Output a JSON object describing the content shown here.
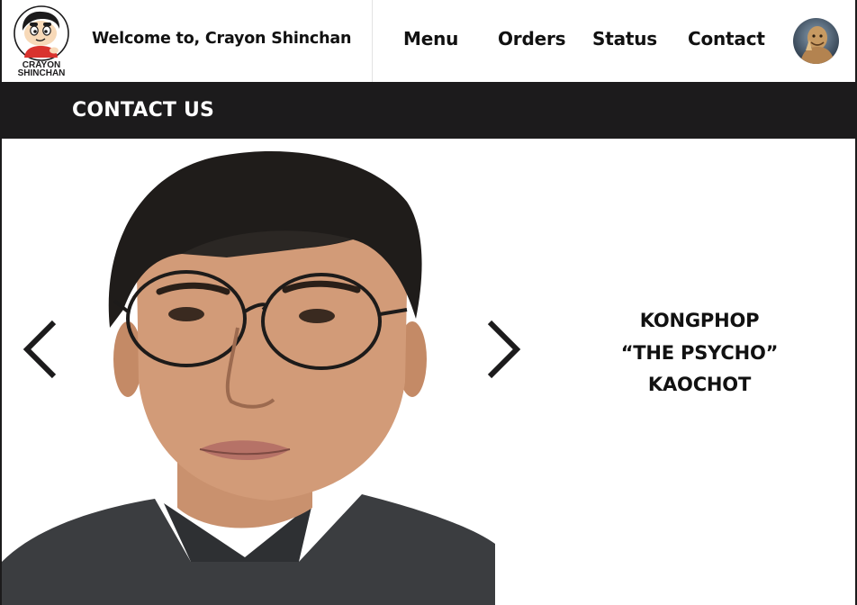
{
  "header": {
    "logo_lines": [
      "CRAYON",
      "SHINCHAN"
    ],
    "welcome_text": "Welcome to, Crayon Shinchan",
    "nav": [
      {
        "label": "Menu"
      },
      {
        "label": "Orders"
      },
      {
        "label": "Status"
      },
      {
        "label": "Contact"
      }
    ]
  },
  "band": {
    "title": "CONTACT US"
  },
  "carousel": {
    "prev_icon": "chevron-left-icon",
    "next_icon": "chevron-right-icon",
    "person_name": [
      "KONGPHOP",
      "“THE PSYCHO”",
      "KAOCHOT"
    ]
  },
  "colors": {
    "band_bg": "#1c1b1c",
    "text": "#111111",
    "logo_red": "#d9332e"
  }
}
